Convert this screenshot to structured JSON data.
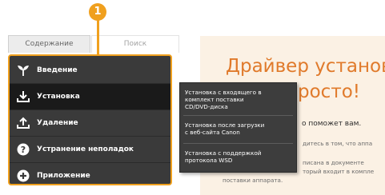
{
  "callout": {
    "number": "1"
  },
  "tabs": {
    "contents": "Содержание",
    "search": "Поиск"
  },
  "nav": {
    "items": [
      {
        "label": "Введение",
        "icon": "sprout-icon"
      },
      {
        "label": "Установка",
        "icon": "install-icon",
        "active": true
      },
      {
        "label": "Удаление",
        "icon": "uninstall-icon"
      },
      {
        "label": "Устранение неполадок",
        "icon": "help-icon"
      },
      {
        "label": "Приложение",
        "icon": "plus-icon"
      }
    ]
  },
  "submenu": {
    "items": [
      {
        "line1": "Установка с входящего в",
        "line2": "комплект поставки",
        "line3": "CD/DVD-диска"
      },
      {
        "line1": "Установка после загрузки",
        "line2": "с веб-сайта Canon"
      },
      {
        "line1": "Установка с поддержкой",
        "line2": "протокола WSD"
      }
    ]
  },
  "content": {
    "title_line1": "Драйвер установ",
    "title_line2": "росто!",
    "subtitle": "о поможет вам.",
    "text_lines": [
      "дитесь в том, что аппа",
      "писана в документе",
      "торый входит в компле",
      "поставки аппарата."
    ]
  },
  "colors": {
    "accent": "#f0a01e",
    "title": "#e07a2b",
    "nav_bg": "#3a3a3a",
    "nav_active": "#1a1a1a"
  }
}
